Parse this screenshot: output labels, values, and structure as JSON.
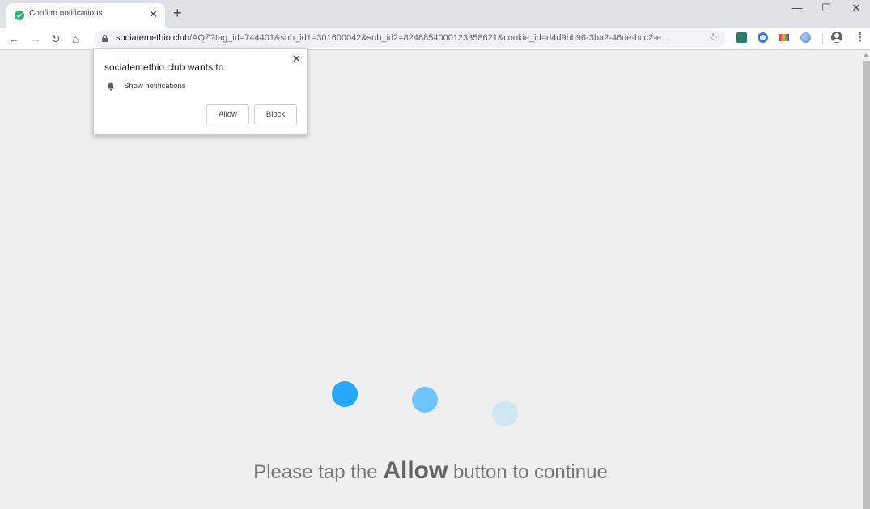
{
  "browser": {
    "tab": {
      "title": "Confirm notifications",
      "close_glyph": "✕",
      "favicon": "check-circle-icon"
    },
    "new_tab_glyph": "+",
    "window_controls": {
      "minimize": "—",
      "maximize": "☐",
      "close": "✕"
    },
    "nav": {
      "back": "←",
      "forward": "→",
      "reload": "↻",
      "home": "⌂"
    },
    "url_host": "sociatemethio.club",
    "url_rest": "/AQZ?tag_id=744401&sub_id1=301600042&sub_id2=8248854000123358621&cookie_id=d4d9bb96-3ba2-46de-bcc2-e...",
    "star_glyph": "☆",
    "menu_glyph": "⋮",
    "extensions": [
      "extension-1-icon",
      "extension-2-icon",
      "extension-3-icon",
      "extension-4-icon"
    ]
  },
  "popup": {
    "title": "sociatemethio.club wants to",
    "permission": "Show notifications",
    "close_glyph": "✕",
    "allow_label": "Allow",
    "block_label": "Block"
  },
  "page": {
    "message_before": "Please tap the ",
    "message_bold": "Allow",
    "message_after": " button to continue",
    "dot_colors": [
      "#27a7fc",
      "#6ec4fb",
      "#cfe7f2"
    ]
  }
}
